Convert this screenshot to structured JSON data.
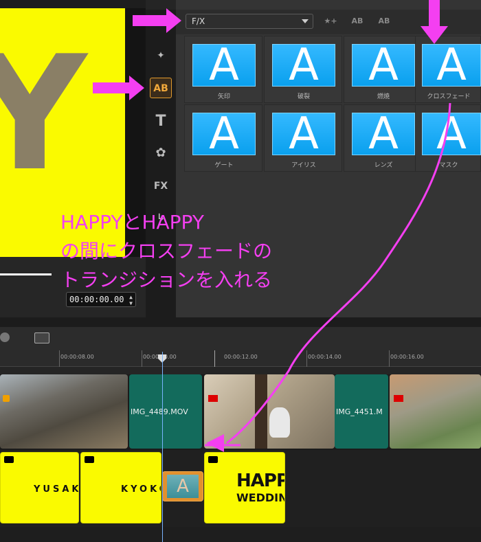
{
  "preview": {
    "timecode": "00:00:00.00"
  },
  "library": {
    "category": "F/X",
    "tiles": [
      {
        "thumb": "A",
        "label": "矢印"
      },
      {
        "thumb": "A",
        "label": "破裂"
      },
      {
        "thumb": "A",
        "label": "燃焼"
      },
      {
        "thumb": "A",
        "label": "クロスフェード"
      },
      {
        "thumb": "A",
        "label": "ゲート"
      },
      {
        "thumb": "A",
        "label": "アイリス"
      },
      {
        "thumb": "A",
        "label": "レンズ"
      },
      {
        "thumb": "A",
        "label": "マスク"
      }
    ]
  },
  "side_icons": [
    "magic-wand-icon",
    "transition-ab-icon",
    "title-t-icon",
    "graphics-icon",
    "fx-icon",
    "path-icon"
  ],
  "side_labels": {
    "ab": "AB",
    "t": "T",
    "fx": "FX"
  },
  "ruler": [
    "00:00:08.00",
    "00:00:10.00",
    "00:00:12.00",
    "00:00:14.00",
    "00:00:16.00"
  ],
  "video_track": {
    "clip1_name": "IMG_4489.MOV",
    "clip2_name": "IMG_4451.M"
  },
  "title_track": {
    "clip1_text": "YUSAK",
    "clip2_text": "KYOKO",
    "clip3_text1": "HAPP",
    "clip3_text2": "WEDDIN",
    "transition_glyph": "A"
  },
  "annotation": {
    "line1": "HAPPYとHAPPY",
    "line2": "の間にクロスフェードの",
    "line3": "トランジションを入れる"
  },
  "colors": {
    "annotation": "#f43ff1",
    "accent": "#e39b2c",
    "thumb": "#1aacf5",
    "title_clip": "#fafa00",
    "video_clip": "#136b5c"
  }
}
